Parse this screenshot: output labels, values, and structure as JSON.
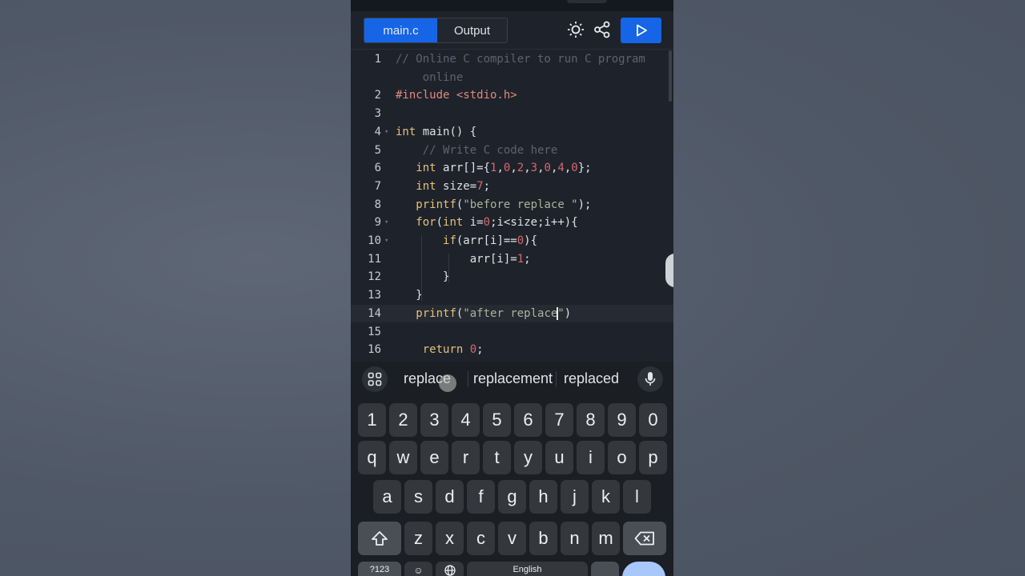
{
  "toolbar": {
    "tabs": [
      {
        "label": "main.c",
        "active": true
      },
      {
        "label": "Output",
        "active": false
      }
    ],
    "icons": [
      "sun-icon",
      "share-icon",
      "play-icon"
    ],
    "accent_color": "#1565e6"
  },
  "editor": {
    "lines": [
      {
        "n": "1",
        "parts": [
          {
            "t": "// Online C compiler to run C program",
            "c": "cmt"
          }
        ]
      },
      {
        "n": "",
        "parts": [
          {
            "t": "    online",
            "c": "cmt"
          }
        ]
      },
      {
        "n": "2",
        "parts": [
          {
            "t": "#include <stdio.h>",
            "c": "pre"
          }
        ]
      },
      {
        "n": "3",
        "parts": []
      },
      {
        "n": "4",
        "fold": true,
        "parts": [
          {
            "t": "int",
            "c": "kw"
          },
          {
            "t": " main() {",
            "c": "plain"
          }
        ]
      },
      {
        "n": "5",
        "parts": [
          {
            "t": "    // Write C code here",
            "c": "cmt"
          }
        ]
      },
      {
        "n": "6",
        "parts": [
          {
            "t": "   ",
            "c": "plain"
          },
          {
            "t": "int",
            "c": "kw"
          },
          {
            "t": " arr[]={",
            "c": "plain"
          },
          {
            "t": "1",
            "c": "num"
          },
          {
            "t": ",",
            "c": "plain"
          },
          {
            "t": "0",
            "c": "num"
          },
          {
            "t": ",",
            "c": "plain"
          },
          {
            "t": "2",
            "c": "num"
          },
          {
            "t": ",",
            "c": "plain"
          },
          {
            "t": "3",
            "c": "num"
          },
          {
            "t": ",",
            "c": "plain"
          },
          {
            "t": "0",
            "c": "num"
          },
          {
            "t": ",",
            "c": "plain"
          },
          {
            "t": "4",
            "c": "num"
          },
          {
            "t": ",",
            "c": "plain"
          },
          {
            "t": "0",
            "c": "num"
          },
          {
            "t": "};",
            "c": "plain"
          }
        ]
      },
      {
        "n": "7",
        "parts": [
          {
            "t": "   ",
            "c": "plain"
          },
          {
            "t": "int",
            "c": "kw"
          },
          {
            "t": " size=",
            "c": "plain"
          },
          {
            "t": "7",
            "c": "num"
          },
          {
            "t": ";",
            "c": "plain"
          }
        ]
      },
      {
        "n": "8",
        "parts": [
          {
            "t": "   ",
            "c": "plain"
          },
          {
            "t": "printf",
            "c": "kw"
          },
          {
            "t": "(",
            "c": "plain"
          },
          {
            "t": "\"before replace \"",
            "c": "str"
          },
          {
            "t": ");",
            "c": "plain"
          }
        ]
      },
      {
        "n": "9",
        "fold": true,
        "parts": [
          {
            "t": "   ",
            "c": "plain"
          },
          {
            "t": "for",
            "c": "kw"
          },
          {
            "t": "(",
            "c": "plain"
          },
          {
            "t": "int",
            "c": "kw"
          },
          {
            "t": " i=",
            "c": "plain"
          },
          {
            "t": "0",
            "c": "num"
          },
          {
            "t": ";i<size;i++){",
            "c": "plain"
          }
        ]
      },
      {
        "n": "10",
        "fold": true,
        "parts": [
          {
            "t": "       ",
            "c": "plain"
          },
          {
            "t": "if",
            "c": "kw"
          },
          {
            "t": "(arr[i]==",
            "c": "plain"
          },
          {
            "t": "0",
            "c": "num"
          },
          {
            "t": "){",
            "c": "plain"
          }
        ]
      },
      {
        "n": "11",
        "parts": [
          {
            "t": "           arr[i]=",
            "c": "plain"
          },
          {
            "t": "1",
            "c": "num"
          },
          {
            "t": ";",
            "c": "plain"
          }
        ]
      },
      {
        "n": "12",
        "parts": [
          {
            "t": "       }",
            "c": "plain"
          }
        ]
      },
      {
        "n": "13",
        "parts": [
          {
            "t": "   }",
            "c": "plain"
          }
        ]
      },
      {
        "n": "14",
        "current": true,
        "parts": [
          {
            "t": "   ",
            "c": "plain"
          },
          {
            "t": "printf",
            "c": "kw"
          },
          {
            "t": "(",
            "c": "plain"
          },
          {
            "t": "\"after replace",
            "c": "str"
          },
          {
            "t": "|caret|",
            "c": "caret"
          },
          {
            "t": "\"",
            "c": "str"
          },
          {
            "t": ")",
            "c": "plain"
          }
        ]
      },
      {
        "n": "15",
        "parts": []
      },
      {
        "n": "16",
        "parts": [
          {
            "t": "    ",
            "c": "plain"
          },
          {
            "t": "return",
            "c": "kw"
          },
          {
            "t": " ",
            "c": "plain"
          },
          {
            "t": "0",
            "c": "num"
          },
          {
            "t": ";",
            "c": "plain"
          }
        ]
      }
    ]
  },
  "keyboard": {
    "suggestions": [
      "replace",
      "replacement",
      "replaced"
    ],
    "rows": [
      [
        "1",
        "2",
        "3",
        "4",
        "5",
        "6",
        "7",
        "8",
        "9",
        "0"
      ],
      [
        "q",
        "w",
        "e",
        "r",
        "t",
        "y",
        "u",
        "i",
        "o",
        "p"
      ],
      [
        "a",
        "s",
        "d",
        "f",
        "g",
        "h",
        "j",
        "k",
        "l"
      ],
      [
        "z",
        "x",
        "c",
        "v",
        "b",
        "n",
        "m"
      ]
    ],
    "bottom_row": [
      "?123",
      "☺",
      "English"
    ]
  }
}
